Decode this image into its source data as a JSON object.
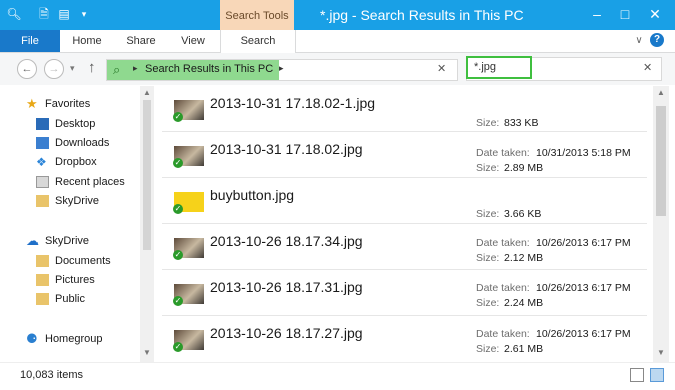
{
  "window": {
    "title": "*.jpg - Search Results in This PC",
    "context_tab": "Search Tools",
    "colors": {
      "titlebar": "#19a0e6",
      "file_tab": "#1979ca",
      "context_tab": "#f8d7b8",
      "address_highlight": "#8fd98f",
      "search_highlight": "#3fbf3f"
    }
  },
  "ribbon": {
    "tabs": [
      {
        "label": "File"
      },
      {
        "label": "Home"
      },
      {
        "label": "Share"
      },
      {
        "label": "View"
      },
      {
        "label": "Search"
      }
    ]
  },
  "address": {
    "location": "Search Results in This PC"
  },
  "search": {
    "value": "*.jpg"
  },
  "sidebar": {
    "favorites_header": "Favorites",
    "favorites": [
      {
        "label": "Desktop",
        "icon": "desktop-icon"
      },
      {
        "label": "Downloads",
        "icon": "downloads-icon"
      },
      {
        "label": "Dropbox",
        "icon": "dropbox-icon"
      },
      {
        "label": "Recent places",
        "icon": "recent-places-icon"
      },
      {
        "label": "SkyDrive",
        "icon": "skydrive-icon"
      }
    ],
    "skydrive_header": "SkyDrive",
    "skydrive": [
      {
        "label": "Documents",
        "icon": "folder-icon"
      },
      {
        "label": "Pictures",
        "icon": "folder-icon"
      },
      {
        "label": "Public",
        "icon": "folder-icon"
      }
    ],
    "homegroup": "Homegroup"
  },
  "results": [
    {
      "name": "2013-10-31 17.18.02-1.jpg",
      "date_label": "",
      "date": "",
      "size_label": "Size:",
      "size": "833 KB"
    },
    {
      "name": "2013-10-31 17.18.02.jpg",
      "date_label": "Date taken:",
      "date": "10/31/2013 5:18 PM",
      "size_label": "Size:",
      "size": "2.89 MB"
    },
    {
      "name": "buybutton.jpg",
      "date_label": "",
      "date": "",
      "size_label": "Size:",
      "size": "3.66 KB"
    },
    {
      "name": "2013-10-26 18.17.34.jpg",
      "date_label": "Date taken:",
      "date": "10/26/2013 6:17 PM",
      "size_label": "Size:",
      "size": "2.12 MB"
    },
    {
      "name": "2013-10-26 18.17.31.jpg",
      "date_label": "Date taken:",
      "date": "10/26/2013 6:17 PM",
      "size_label": "Size:",
      "size": "2.24 MB"
    },
    {
      "name": "2013-10-26 18.17.27.jpg",
      "date_label": "Date taken:",
      "date": "10/26/2013 6:17 PM",
      "size_label": "Size:",
      "size": "2.61 MB"
    }
  ],
  "status": {
    "count": "10,083 items"
  }
}
